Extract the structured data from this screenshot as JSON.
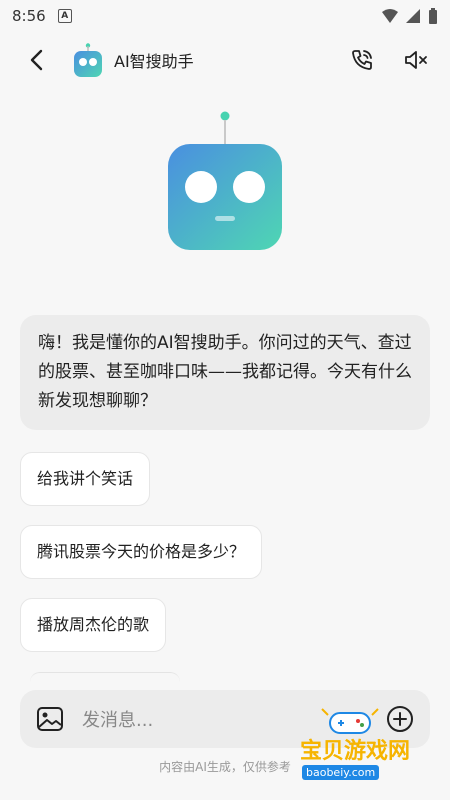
{
  "status": {
    "time": "8:56"
  },
  "appbar": {
    "title": "AI智搜助手"
  },
  "chat": {
    "greeting": "嗨！我是懂你的AI智搜助手。你问过的天气、查过的股票、甚至咖啡口味——我都记得。今天有什么新发现想聊聊？",
    "suggestions": [
      "给我讲个笑话",
      "腾讯股票今天的价格是多少？",
      "播放周杰伦的歌"
    ]
  },
  "input": {
    "placeholder": "发消息..."
  },
  "footer": {
    "note": "内容由AI生成，仅供参考"
  },
  "watermark": {
    "text": "宝贝游戏网",
    "url": "baobeiy.com"
  },
  "colors": {
    "robot_gradient_start": "#4a8fe0",
    "robot_gradient_end": "#4fd6b3",
    "antenna": "#46d3b0"
  }
}
